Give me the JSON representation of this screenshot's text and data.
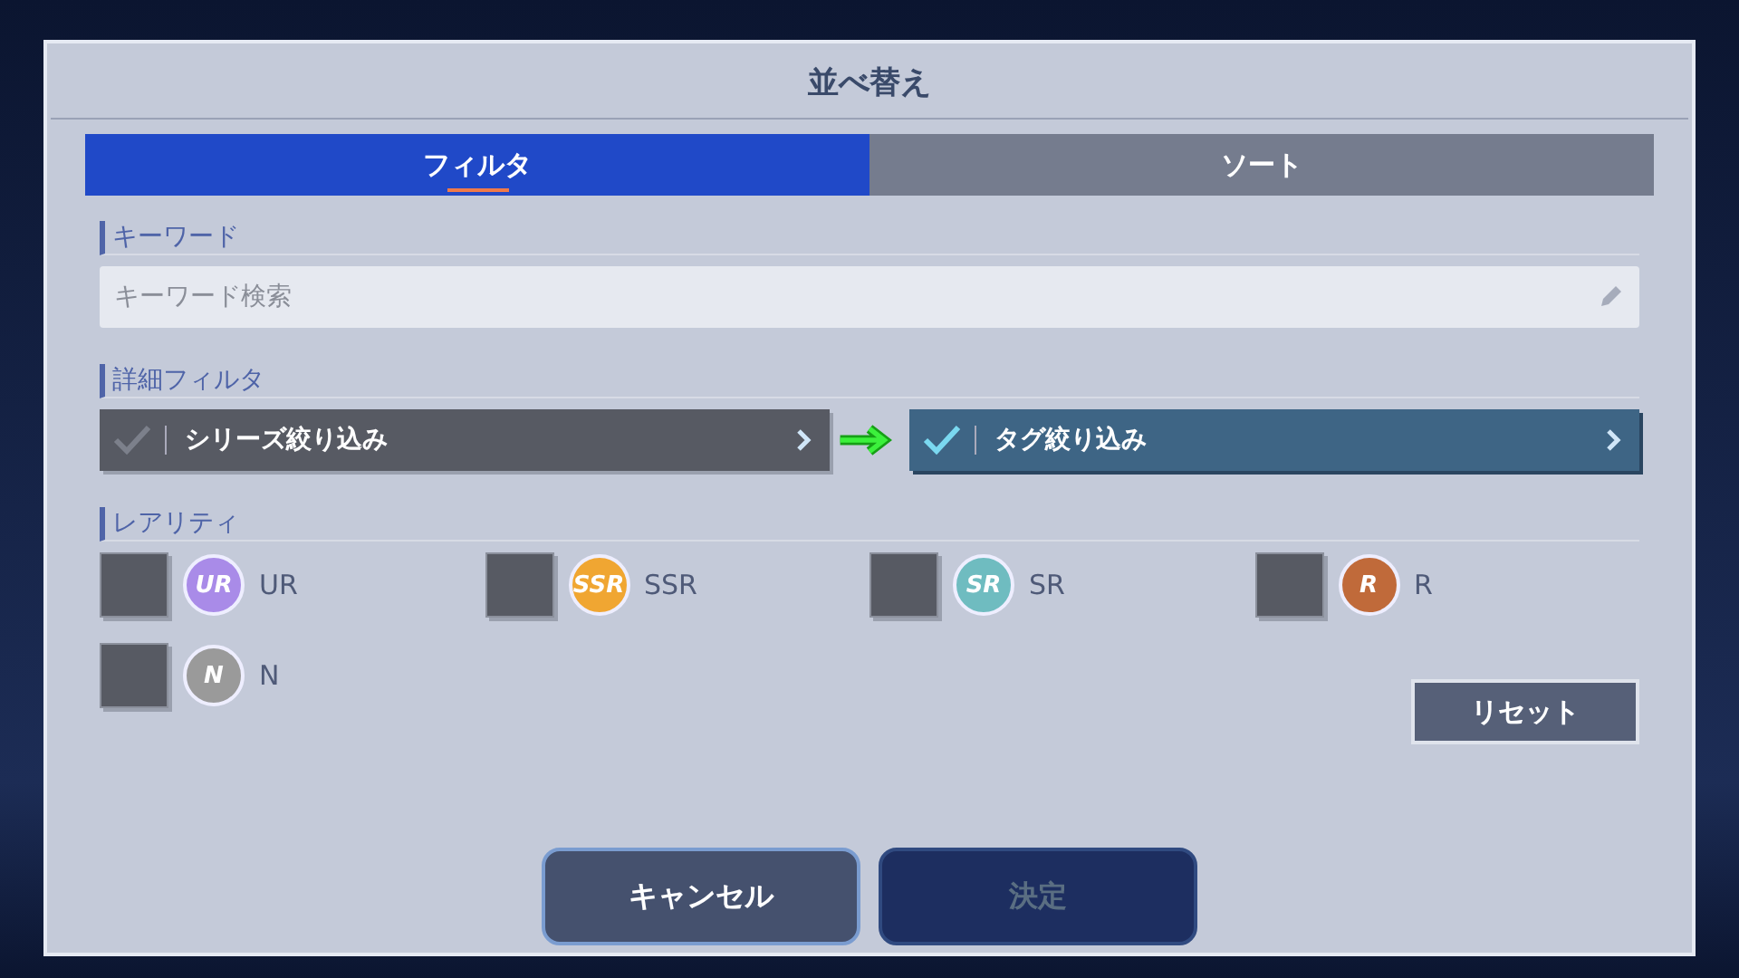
{
  "window": {
    "title": "並べ替え"
  },
  "tabs": [
    {
      "label": "フィルタ",
      "selected": true
    },
    {
      "label": "ソート",
      "selected": false
    }
  ],
  "keyword": {
    "heading": "キーワード",
    "search": {
      "placeholder": "キーワード検索"
    }
  },
  "detail_filter": {
    "heading": "詳細フィルタ",
    "options": [
      {
        "label": "シリーズ絞り込み",
        "checked": false
      },
      {
        "label": "タグ絞り込み",
        "checked": true
      }
    ]
  },
  "rarity": {
    "heading": "レアリティ",
    "items": [
      {
        "badge": "UR",
        "label": "UR",
        "checked": false,
        "color": "#a98be8"
      },
      {
        "badge": "SSR",
        "label": "SSR",
        "checked": false,
        "color": "#f0a632"
      },
      {
        "badge": "SR",
        "label": "SR",
        "checked": false,
        "color": "#6fbcc0"
      },
      {
        "badge": "R",
        "label": "R",
        "checked": false,
        "color": "#c06a3a"
      },
      {
        "badge": "N",
        "label": "N",
        "checked": false,
        "color": "#9a9a9a"
      }
    ]
  },
  "reset_button": "リセット",
  "buttons": [
    {
      "label": "キャンセル",
      "disabled": false
    },
    {
      "label": "決定",
      "disabled": true
    }
  ]
}
